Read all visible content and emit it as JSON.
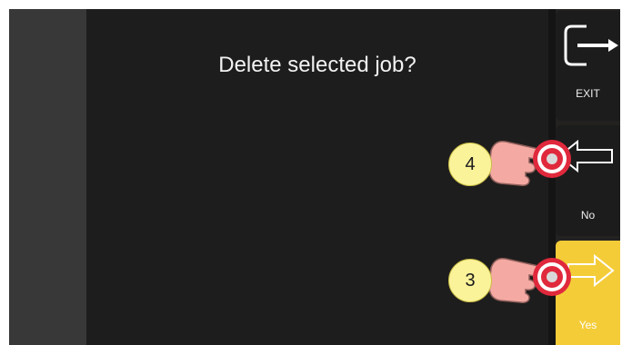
{
  "dialog": {
    "prompt": "Delete selected job?"
  },
  "side_buttons": {
    "exit": {
      "label": "EXIT",
      "icon": "exit-arrow-icon"
    },
    "no": {
      "label": "No",
      "icon": "arrow-left-icon"
    },
    "yes": {
      "label": "Yes",
      "icon": "arrow-right-icon"
    }
  },
  "callouts": [
    {
      "number": "4",
      "target": "no"
    },
    {
      "number": "3",
      "target": "yes"
    }
  ],
  "colors": {
    "background": "#232221",
    "panel": "#1e1d1d",
    "yes_button": "#f4cc38",
    "badge": "#fbf39a",
    "press_marker": "#e0293c",
    "hand": "#f4a9a3"
  }
}
